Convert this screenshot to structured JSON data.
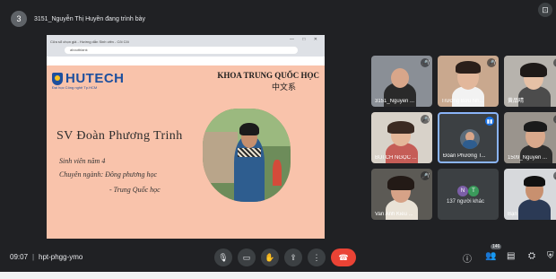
{
  "top": {
    "avatar_letter": "3",
    "presenter_label": "3151_Nguyễn Thị Huyền đang trình bày"
  },
  "browser": {
    "tab_title": "Cửa sổ chọn giả - Hướng dẫn Sinh viên - Cõi Cõi",
    "url": "aboutblank",
    "controls": "— □ ✕"
  },
  "slide": {
    "logo": "HUTECH",
    "logo_sub": "Đại học Công nghệ Tp.HCM",
    "title": "KHOA TRUNG QUỐC HỌC",
    "subtitle": "中文系",
    "student_name": "SV Đoàn Phương Trinh",
    "line1": "Sinh viên năm 4",
    "line2": "Chuyên ngành: Đông phương học",
    "line3": "- Trung Quốc học"
  },
  "participants": [
    {
      "name": "3151_Nguyễn ...",
      "mic": "🎤̸"
    },
    {
      "name": "Trương Bửu Nh...",
      "mic": "🎤̸"
    },
    {
      "name": "黄品晴",
      "mic": "🎤̸"
    },
    {
      "name": "BÙI CH NGỌC ...",
      "mic": "🎤̸"
    },
    {
      "name": "Đoàn Phương T...",
      "mic": "▮▮"
    },
    {
      "name": "1509_Nguyễn ...",
      "mic": "🎤̸"
    },
    {
      "name": "Van Anh Kiều ...",
      "mic": "🎤̸"
    },
    {
      "name": "137 người khác",
      "mic": ""
    },
    {
      "name": "Bạn",
      "mic": "🎤̸"
    }
  ],
  "others": {
    "letter1": "N",
    "letter2": "T"
  },
  "bottom": {
    "time": "09:07",
    "separator": "|",
    "meeting_code": "hpt-phgg-ymo",
    "people_count": "146"
  },
  "colors": {
    "background": "#202124",
    "slide_bg": "#f9c3ab",
    "end_call": "#ea4335",
    "active_border": "#8ab4f8"
  }
}
